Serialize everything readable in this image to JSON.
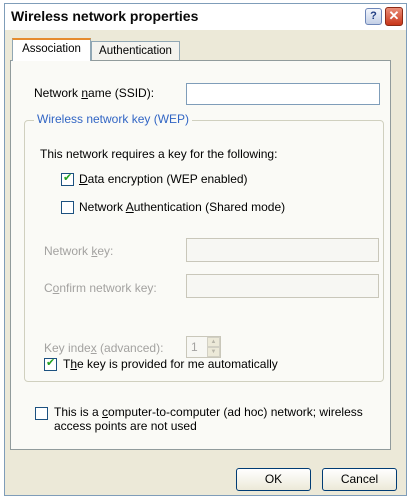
{
  "window": {
    "title": "Wireless network properties",
    "help_glyph": "?",
    "close_glyph": "✕"
  },
  "tabs": [
    {
      "label": "Association",
      "active": true
    },
    {
      "label": "Authentication",
      "active": false
    }
  ],
  "ssid": {
    "label_pre": "Network ",
    "label_u": "n",
    "label_post": "ame (SSID):",
    "value": ""
  },
  "wep_group": {
    "legend": "Wireless network key (WEP)",
    "intro": "This network requires a key for the following:",
    "data_encryption": {
      "label_u": "D",
      "label_post": "ata encryption (WEP enabled)",
      "checked": true
    },
    "network_auth": {
      "label_pre": "Network ",
      "label_u": "A",
      "label_post": "uthentication (Shared mode)",
      "checked": false
    },
    "network_key": {
      "label_pre": "Network ",
      "label_u": "k",
      "label_post": "ey:",
      "value": ""
    },
    "confirm_key": {
      "label_pre": "C",
      "label_u": "o",
      "label_post": "nfirm network key:",
      "value": ""
    },
    "key_index": {
      "label_pre": "Key inde",
      "label_u": "x",
      "label_post": " (advanced):",
      "value": "1"
    },
    "auto_key": {
      "label_pre": "T",
      "label_u": "h",
      "label_post": "e key is provided for me automatically",
      "checked": true
    }
  },
  "adhoc": {
    "line1_pre": "This is a ",
    "line1_u": "c",
    "line1_post": "omputer-to-computer (ad hoc) network; wireless",
    "line2": "access points are not used",
    "checked": false
  },
  "buttons": {
    "ok": "OK",
    "cancel": "Cancel"
  },
  "colors": {
    "tab_accent": "#e68b2c",
    "group_legend": "#3165c4",
    "check_mark": "#21a121"
  }
}
